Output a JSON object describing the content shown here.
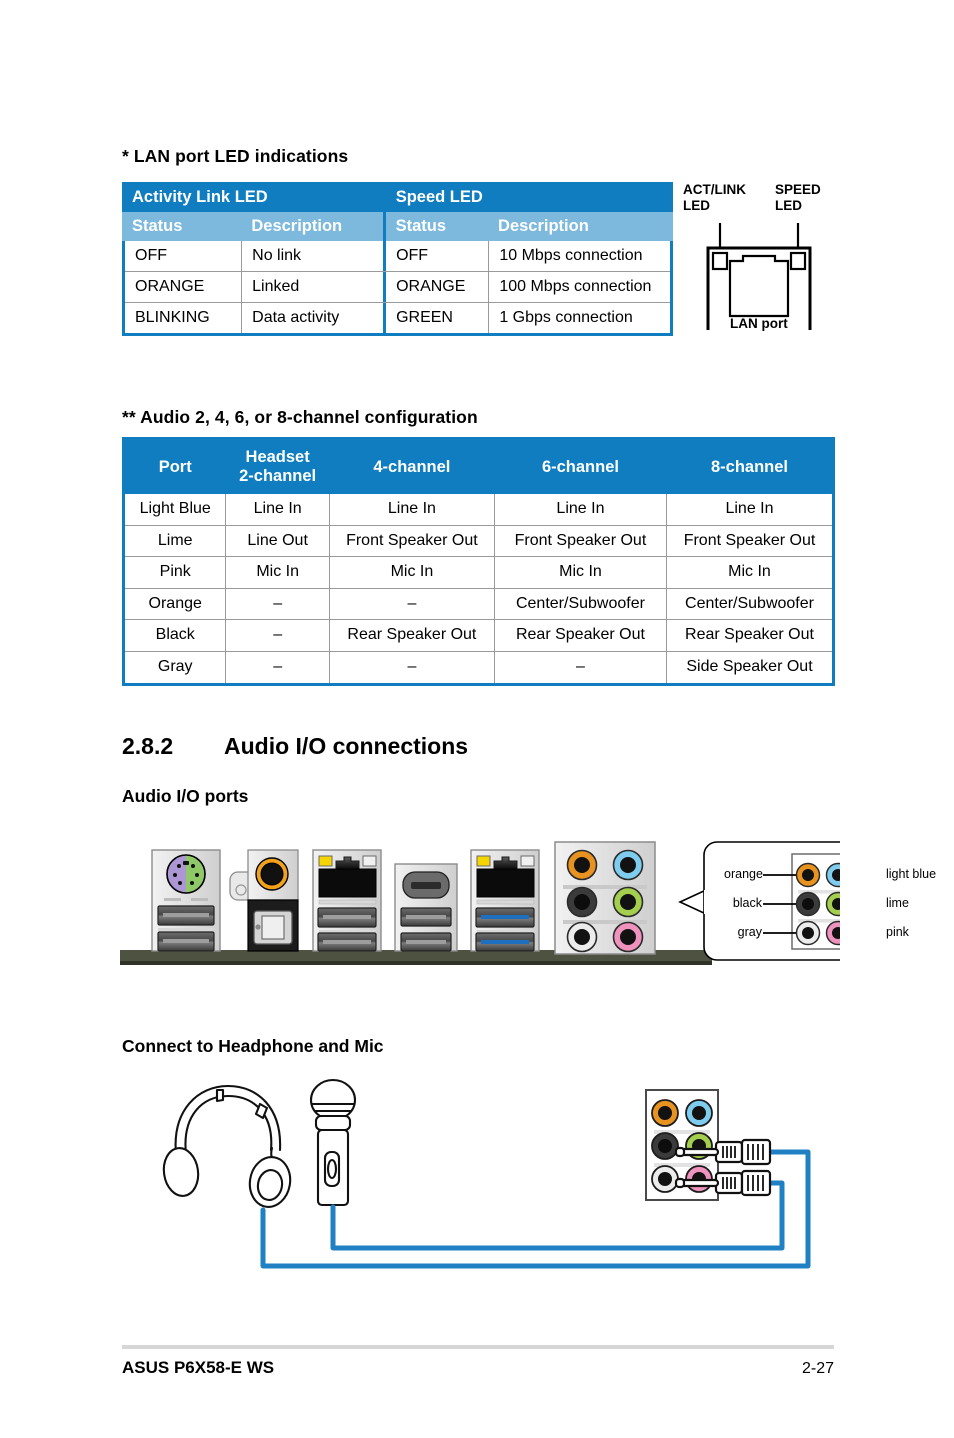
{
  "lan_led": {
    "heading": "* LAN port LED indications",
    "group_headers": [
      "Activity Link LED",
      "Speed LED"
    ],
    "sub_headers": [
      "Status",
      "Description",
      "Status",
      "Description"
    ],
    "rows": [
      [
        "OFF",
        "No link",
        "OFF",
        "10 Mbps connection"
      ],
      [
        "ORANGE",
        "Linked",
        "ORANGE",
        "100 Mbps connection"
      ],
      [
        "BLINKING",
        "Data activity",
        "GREEN",
        "1 Gbps connection"
      ]
    ]
  },
  "lan_figure": {
    "act_link_label_line1": "ACT/LINK",
    "act_link_label_line2": "LED",
    "speed_label_line1": "SPEED",
    "speed_label_line2": "LED",
    "caption": "LAN port"
  },
  "audio_config": {
    "heading": "** Audio 2, 4, 6, or 8-channel configuration",
    "headers": [
      "Port",
      "Headset\n2-channel",
      "4-channel",
      "6-channel",
      "8-channel"
    ],
    "header_port": "Port",
    "header_headset_l1": "Headset",
    "header_headset_l2": "2-channel",
    "header_4ch": "4-channel",
    "header_6ch": "6-channel",
    "header_8ch": "8-channel",
    "rows": [
      [
        "Light Blue",
        "Line In",
        "Line In",
        "Line In",
        "Line In"
      ],
      [
        "Lime",
        "Line Out",
        "Front Speaker Out",
        "Front Speaker Out",
        "Front Speaker Out"
      ],
      [
        "Pink",
        "Mic In",
        "Mic In",
        "Mic In",
        "Mic In"
      ],
      [
        "Orange",
        "–",
        "–",
        "Center/Subwoofer",
        "Center/Subwoofer"
      ],
      [
        "Black",
        "–",
        "Rear Speaker Out",
        "Rear Speaker Out",
        "Rear Speaker Out"
      ],
      [
        "Gray",
        "–",
        "–",
        "–",
        "Side Speaker Out"
      ]
    ]
  },
  "section": {
    "number": "2.8.2",
    "title": "Audio I/O connections",
    "ports_heading": "Audio I/O ports",
    "headphone_heading": "Connect to Headphone and Mic"
  },
  "callout": {
    "labels_left": [
      "orange",
      "black",
      "gray"
    ],
    "labels_right": [
      "light blue",
      "lime",
      "pink"
    ]
  },
  "colors": {
    "table_header_blue": "#0f7dc0",
    "table_subheader_blue": "#7cb9dd",
    "cable_blue": "#1f80c4",
    "jack_orange": "#e8921f",
    "jack_light_blue": "#7fcdee",
    "jack_black": "#3b3b3b",
    "jack_lime": "#a4ce4e",
    "jack_gray": "#e6e6e6",
    "jack_pink": "#ef92bd",
    "ps2_purple": "#ac96d4",
    "ps2_green": "#8fc866",
    "usb3_blue": "#1f6fc0",
    "lan_led_yellow": "#f5d400"
  },
  "footer": {
    "left": "ASUS P6X58-E WS",
    "right": "2-27"
  }
}
